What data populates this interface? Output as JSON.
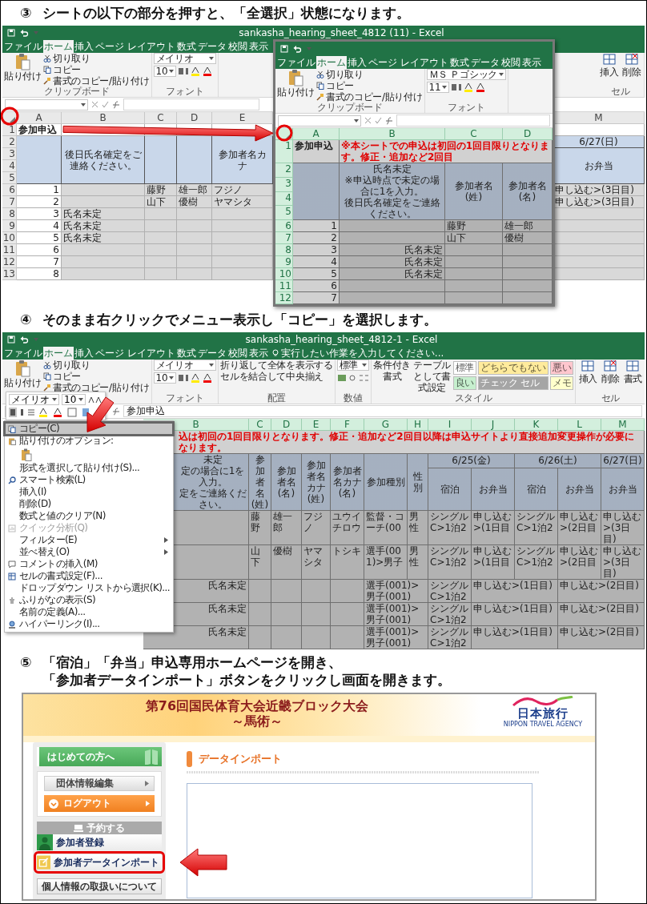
{
  "steps": [
    {
      "marker": "③",
      "lines": [
        "シートの以下の部分を押すと、「全選択」状態になります。"
      ],
      "figure": {
        "kind": "excel-zoom",
        "sheets": [
          {
            "kind": "back",
            "title": "sankasha_hearing_sheet_4812 (11) - Excel",
            "all_selected": false,
            "tabs": [
              {
                "label": "ファイル",
                "selected": false
              },
              {
                "label": "ホーム",
                "selected": true
              },
              {
                "label": "挿入",
                "selected": false
              },
              {
                "label": "ページ レイアウト",
                "selected": false
              },
              {
                "label": "数式",
                "selected": false
              },
              {
                "label": "データ",
                "selected": false
              },
              {
                "label": "校閲",
                "selected": false
              },
              {
                "label": "表示",
                "selected": false
              }
            ],
            "ribbon": [
              {
                "kind": "clipboard",
                "paste": "貼り付け",
                "items": [
                  "切り取り",
                  "コピー",
                  "書式のコピー/貼り付け"
                ],
                "label": "クリップボード"
              },
              {
                "kind": "font",
                "font": "メイリオ",
                "size": "10",
                "label": "フォント"
              },
              {
                "kind": "gap"
              },
              {
                "kind": "cells",
                "items": [
                  "挿入",
                  "削除"
                ],
                "label": "セル"
              }
            ],
            "columns": [
              "A",
              "B",
              "C",
              "D",
              "E",
              "M"
            ],
            "rows": [
              {
                "num": "1",
                "kind": "blank",
                "cells": [
                  {
                    "kind": "title",
                    "text": "参加申込"
                  }
                ]
              },
              {
                "num": "2",
                "cells": [
                  {
                    "kind": "header"
                  },
                  {
                    "kind": "header",
                    "text": "後日氏名確定をご連絡ください。"
                  },
                  {
                    "kind": "header"
                  },
                  {
                    "kind": "header"
                  },
                  {
                    "kind": "header",
                    "text": "参加者名カナ"
                  },
                  {
                    "kind": "header",
                    "text": "6/27(日)"
                  }
                ]
              },
              {
                "num": "3",
                "cells": [
                  {
                    "kind": "merge-up"
                  },
                  {
                    "kind": "merge-up"
                  },
                  {
                    "kind": "merge-up"
                  },
                  {
                    "kind": "merge-up"
                  },
                  {
                    "kind": "merge-up"
                  },
                  {
                    "kind": "header",
                    "text": "お弁当"
                  }
                ]
              },
              {
                "num": "4",
                "cells": [
                  {
                    "kind": "merge-up"
                  },
                  {
                    "kind": "merge-up"
                  },
                  {
                    "kind": "merge-up"
                  },
                  {
                    "kind": "merge-up"
                  },
                  {
                    "kind": "merge-up"
                  },
                  {
                    "kind": "merge-up"
                  }
                ]
              },
              {
                "num": "5",
                "cells": [
                  {
                    "kind": "merge-up"
                  },
                  {
                    "kind": "merge-up"
                  },
                  {
                    "kind": "merge-up"
                  },
                  {
                    "kind": "merge-up"
                  },
                  {
                    "kind": "merge-up"
                  },
                  {
                    "kind": "merge-up"
                  }
                ]
              },
              {
                "num": "6",
                "cells": [
                  {
                    "kind": "num",
                    "text": "1"
                  },
                  {
                    "kind": "data"
                  },
                  {
                    "kind": "data",
                    "text": "藤野"
                  },
                  {
                    "kind": "data",
                    "text": "雄一郎"
                  },
                  {
                    "kind": "data",
                    "text": "フジノ"
                  },
                  {
                    "kind": "data",
                    "text": "申し込む>(3日目)"
                  }
                ]
              },
              {
                "num": "7",
                "cells": [
                  {
                    "kind": "num",
                    "text": "2"
                  },
                  {
                    "kind": "data"
                  },
                  {
                    "kind": "data",
                    "text": "山下"
                  },
                  {
                    "kind": "data",
                    "text": "優樹"
                  },
                  {
                    "kind": "data",
                    "text": "ヤマシタ"
                  },
                  {
                    "kind": "data",
                    "text": "申し込む>(3日目)"
                  }
                ]
              },
              {
                "num": "8",
                "kind": "data",
                "cells": [
                  {
                    "kind": "num",
                    "text": "3"
                  },
                  {
                    "kind": "data",
                    "text": "氏名未定"
                  }
                ]
              },
              {
                "num": "9",
                "kind": "data",
                "cells": [
                  {
                    "kind": "num",
                    "text": "4"
                  },
                  {
                    "kind": "data",
                    "text": "氏名未定"
                  }
                ]
              },
              {
                "num": "10",
                "kind": "data",
                "cells": [
                  {
                    "kind": "num",
                    "text": "5"
                  },
                  {
                    "kind": "data",
                    "text": "氏名未定"
                  }
                ]
              },
              {
                "num": "11",
                "kind": "data",
                "cells": [
                  {
                    "kind": "num",
                    "text": "6"
                  }
                ]
              },
              {
                "num": "12",
                "kind": "data",
                "cells": [
                  {
                    "kind": "num",
                    "text": "7"
                  }
                ]
              },
              {
                "num": "13",
                "kind": "data",
                "cells": [
                  {
                    "kind": "num",
                    "text": "8"
                  }
                ]
              }
            ]
          },
          {
            "kind": "zoom",
            "all_selected": true,
            "tabs": [
              {
                "label": "ファイル",
                "selected": false
              },
              {
                "label": "ホーム",
                "selected": true
              },
              {
                "label": "挿入",
                "selected": false
              },
              {
                "label": "ページ レイアウト",
                "selected": false
              },
              {
                "label": "数式",
                "selected": false
              },
              {
                "label": "データ",
                "selected": false
              },
              {
                "label": "校閲",
                "selected": false
              },
              {
                "label": "表示",
                "selected": false
              }
            ],
            "ribbon": [
              {
                "kind": "clipboard",
                "paste": "貼り付け",
                "items": [
                  "切り取り",
                  "コピー",
                  "書式のコピー/貼り付け"
                ],
                "label": "クリップボード"
              },
              {
                "kind": "font",
                "font": "ＭＳ Ｐゴシック",
                "size": "11",
                "label": "フォント"
              }
            ],
            "columns": [
              "A",
              "B",
              "C",
              "D"
            ],
            "rows": [
              {
                "num": "1",
                "cells": [
                  {
                    "kind": "title",
                    "text": "参加申込"
                  },
                  {
                    "kind": "note",
                    "text": "※本シートでの申込は初回の1回目限りとなります。修正・追加など2回目"
                  },
                  {
                    "kind": "merge-left"
                  },
                  {
                    "kind": "merge-left"
                  }
                ]
              },
              {
                "num": "2",
                "cells": [
                  {
                    "kind": "header"
                  },
                  {
                    "kind": "header",
                    "lines": [
                      "氏名未定",
                      "※申込時点で未定の場合に1を入力。",
                      "後日氏名確定をご連絡ください。"
                    ]
                  },
                  {
                    "kind": "header",
                    "text": "参加者名(姓)"
                  },
                  {
                    "kind": "header",
                    "text": "参加者名(名)"
                  }
                ]
              },
              {
                "num": "3",
                "cells": [
                  {
                    "kind": "merge-up"
                  },
                  {
                    "kind": "merge-up"
                  },
                  {
                    "kind": "merge-up"
                  },
                  {
                    "kind": "merge-up"
                  }
                ]
              },
              {
                "num": "4",
                "cells": [
                  {
                    "kind": "merge-up"
                  },
                  {
                    "kind": "merge-up"
                  },
                  {
                    "kind": "merge-up"
                  },
                  {
                    "kind": "merge-up"
                  }
                ]
              },
              {
                "num": "5",
                "cells": [
                  {
                    "kind": "merge-up"
                  },
                  {
                    "kind": "merge-up"
                  },
                  {
                    "kind": "merge-up"
                  },
                  {
                    "kind": "merge-up"
                  }
                ]
              },
              {
                "num": "6",
                "cells": [
                  {
                    "kind": "num",
                    "text": "1"
                  },
                  {
                    "kind": "data"
                  },
                  {
                    "kind": "data",
                    "text": "藤野"
                  },
                  {
                    "kind": "data",
                    "text": "雄一郎"
                  }
                ]
              },
              {
                "num": "7",
                "cells": [
                  {
                    "kind": "num",
                    "text": "2"
                  },
                  {
                    "kind": "data"
                  },
                  {
                    "kind": "data",
                    "text": "山下"
                  },
                  {
                    "kind": "data",
                    "text": "優樹"
                  }
                ]
              },
              {
                "num": "8",
                "kind": "data",
                "cells": [
                  {
                    "kind": "num",
                    "text": "3"
                  },
                  {
                    "kind": "data-right",
                    "text": "氏名未定"
                  }
                ]
              },
              {
                "num": "9",
                "kind": "data",
                "cells": [
                  {
                    "kind": "num",
                    "text": "4"
                  },
                  {
                    "kind": "data-right",
                    "text": "氏名未定"
                  }
                ]
              },
              {
                "num": "10",
                "kind": "data",
                "cells": [
                  {
                    "kind": "num",
                    "text": "5"
                  },
                  {
                    "kind": "data-right",
                    "text": "氏名未定"
                  }
                ]
              },
              {
                "num": "11",
                "kind": "data",
                "cells": [
                  {
                    "kind": "num",
                    "text": "6"
                  }
                ]
              },
              {
                "num": "12",
                "kind": "data",
                "cells": [
                  {
                    "kind": "num",
                    "text": "7"
                  }
                ]
              }
            ]
          }
        ]
      }
    },
    {
      "marker": "④",
      "lines": [
        "そのまま右クリックでメニュー表示し「コピー」を選択します。"
      ],
      "figure": {
        "kind": "excel-menu",
        "sheets": [
          {
            "kind": "menu",
            "title": "sankasha_hearing_sheet_4812-1 - Excel",
            "all_selected": true,
            "tell_me": "実行したい作業を入力してください...",
            "formula": "参加申込",
            "tabs": [
              {
                "label": "ファイル",
                "selected": false
              },
              {
                "label": "ホーム",
                "selected": true
              },
              {
                "label": "挿入",
                "selected": false
              },
              {
                "label": "ページ レイアウト",
                "selected": false
              },
              {
                "label": "数式",
                "selected": false
              },
              {
                "label": "データ",
                "selected": false
              },
              {
                "label": "校閲",
                "selected": false
              },
              {
                "label": "表示",
                "selected": false
              }
            ],
            "ribbon": [
              {
                "kind": "clipboard",
                "paste": "貼り付け",
                "items": [
                  "切り取り",
                  "コピー",
                  "書式のコピー/貼り付け"
                ]
              },
              {
                "kind": "font",
                "font": "メイリオ",
                "size": "10",
                "label": "フォント"
              },
              {
                "kind": "align",
                "items": [
                  "折り返して全体を表示する",
                  "セルを結合して中央揃え"
                ],
                "label": "配置"
              },
              {
                "kind": "number",
                "format": "標準",
                "label": "数値"
              },
              {
                "kind": "styles",
                "commands": [
                  "条件付き書式",
                  "テーブルとして書式設定"
                ],
                "tiles": [
                  {
                    "label": "標準",
                    "color": "#ffffff"
                  },
                  {
                    "label": "どちらでもない",
                    "color": "#ffeb9c"
                  },
                  {
                    "label": "悪い",
                    "color": "#ffc7ce"
                  },
                  {
                    "label": "良い",
                    "color": "#c6efce"
                  },
                  {
                    "label": "チェック セル",
                    "color": "#a5a5a5"
                  },
                  {
                    "label": "メモ",
                    "color": "#ffffcc"
                  }
                ],
                "label": "スタイル"
              },
              {
                "kind": "cells",
                "items": [
                  "挿入",
                  "削除",
                  "書式"
                ],
                "label": "セル"
              }
            ],
            "columns": [
              "B",
              "C",
              "D",
              "E",
              "F",
              "G",
              "H",
              "I",
              "J",
              "K",
              "L",
              "M"
            ],
            "rows": [
              {
                "cells": [
                  {
                    "kind": "note",
                    "text": "込は初回の1回目限りとなります。修正・追加など2回目以降は申込サイトより直接追加変更操作が必要になります。"
                  },
                  {
                    "kind": "merge-left"
                  },
                  {
                    "kind": "merge-left"
                  },
                  {
                    "kind": "merge-left"
                  },
                  {
                    "kind": "merge-left"
                  },
                  {
                    "kind": "merge-left"
                  },
                  {
                    "kind": "merge-left"
                  },
                  {
                    "kind": "merge-left"
                  },
                  {
                    "kind": "merge-left"
                  },
                  {
                    "kind": "merge-left"
                  },
                  {
                    "kind": "merge-left"
                  },
                  {
                    "kind": "merge-left"
                  }
                ]
              },
              {
                "cells": [
                  {
                    "kind": "header",
                    "lines": [
                      "未定",
                      "定の場合に1を入力。",
                      "定をご連絡ください。"
                    ]
                  },
                  {
                    "kind": "header",
                    "text": "参加者名(姓)"
                  },
                  {
                    "kind": "header",
                    "text": "参加者名(名)"
                  },
                  {
                    "kind": "header",
                    "text": "参加者名カナ(姓)"
                  },
                  {
                    "kind": "header",
                    "text": "参加者名カナ(名)"
                  },
                  {
                    "kind": "header",
                    "text": "参加種別"
                  },
                  {
                    "kind": "header",
                    "text": "性別"
                  },
                  {
                    "kind": "header",
                    "text": "6/25(金)"
                  },
                  {
                    "kind": "merge-left"
                  },
                  {
                    "kind": "header",
                    "text": "6/26(土)"
                  },
                  {
                    "kind": "merge-left"
                  },
                  {
                    "kind": "header",
                    "text": "6/27(日)"
                  }
                ]
              },
              {
                "cells": [
                  {
                    "kind": "merge-up"
                  },
                  {
                    "kind": "merge-up"
                  },
                  {
                    "kind": "merge-up"
                  },
                  {
                    "kind": "merge-up"
                  },
                  {
                    "kind": "merge-up"
                  },
                  {
                    "kind": "merge-up"
                  },
                  {
                    "kind": "merge-up"
                  },
                  {
                    "kind": "header",
                    "text": "宿泊"
                  },
                  {
                    "kind": "header",
                    "text": "お弁当"
                  },
                  {
                    "kind": "header",
                    "text": "宿泊"
                  },
                  {
                    "kind": "header",
                    "text": "お弁当"
                  },
                  {
                    "kind": "header",
                    "text": "お弁当"
                  }
                ]
              },
              {
                "cells": [
                  {
                    "kind": "merge-up"
                  },
                  {
                    "kind": "merge-up"
                  },
                  {
                    "kind": "merge-up"
                  },
                  {
                    "kind": "merge-up"
                  },
                  {
                    "kind": "merge-up"
                  },
                  {
                    "kind": "merge-up"
                  },
                  {
                    "kind": "merge-up"
                  },
                  {
                    "kind": "merge-up"
                  },
                  {
                    "kind": "merge-up"
                  },
                  {
                    "kind": "merge-up"
                  },
                  {
                    "kind": "merge-up"
                  },
                  {
                    "kind": "merge-up"
                  }
                ]
              },
              {
                "cells": [
                  {
                    "kind": "merge-up"
                  },
                  {
                    "kind": "merge-up"
                  },
                  {
                    "kind": "merge-up"
                  },
                  {
                    "kind": "merge-up"
                  },
                  {
                    "kind": "merge-up"
                  },
                  {
                    "kind": "merge-up"
                  },
                  {
                    "kind": "merge-up"
                  },
                  {
                    "kind": "merge-up"
                  },
                  {
                    "kind": "merge-up"
                  },
                  {
                    "kind": "merge-up"
                  },
                  {
                    "kind": "merge-up"
                  },
                  {
                    "kind": "merge-up"
                  }
                ]
              },
              {
                "cells": [
                  {
                    "kind": "data"
                  },
                  {
                    "kind": "data",
                    "text": "藤野"
                  },
                  {
                    "kind": "data",
                    "text": "雄一郎"
                  },
                  {
                    "kind": "data",
                    "text": "フジノ"
                  },
                  {
                    "kind": "data",
                    "text": "ユウイチロウ"
                  },
                  {
                    "kind": "data",
                    "text": "監督・コーチ(00"
                  },
                  {
                    "kind": "data",
                    "text": "男性"
                  },
                  {
                    "kind": "data",
                    "text": "シングルC>1泊2"
                  },
                  {
                    "kind": "data",
                    "text": "申し込む>(1日目"
                  },
                  {
                    "kind": "data",
                    "text": "シングルC>1泊2"
                  },
                  {
                    "kind": "data",
                    "text": "申し込む>(2日目"
                  },
                  {
                    "kind": "data",
                    "text": "申し込む>(3日目)"
                  }
                ]
              },
              {
                "cells": [
                  {
                    "kind": "data"
                  },
                  {
                    "kind": "data",
                    "text": "山下"
                  },
                  {
                    "kind": "data",
                    "text": "優樹"
                  },
                  {
                    "kind": "data",
                    "text": "ヤマシタ"
                  },
                  {
                    "kind": "data",
                    "text": "トシキ"
                  },
                  {
                    "kind": "data",
                    "text": "選手(001)>男子"
                  },
                  {
                    "kind": "data",
                    "text": "男性"
                  },
                  {
                    "kind": "data",
                    "text": "シングルC>1泊2"
                  },
                  {
                    "kind": "data",
                    "text": "申し込む>(1日目"
                  },
                  {
                    "kind": "data",
                    "text": "シングルC>1泊2"
                  },
                  {
                    "kind": "data",
                    "text": "申し込む>(2日目"
                  },
                  {
                    "kind": "data",
                    "text": "申し込む>(3日目)"
                  }
                ]
              },
              {
                "cells": [
                  {
                    "kind": "data-right",
                    "text": "氏名未定"
                  },
                  {
                    "kind": "data"
                  },
                  {
                    "kind": "data"
                  },
                  {
                    "kind": "data"
                  },
                  {
                    "kind": "data"
                  },
                  {
                    "kind": "data",
                    "text": "選手(001)>男子(001)"
                  },
                  {
                    "kind": "merge-left"
                  },
                  {
                    "kind": "data",
                    "text": "シングルC>1泊2"
                  },
                  {
                    "kind": "data",
                    "text": "申し込む>(1日目)"
                  },
                  {
                    "kind": "merge-left"
                  },
                  {
                    "kind": "data",
                    "text": "申し込む>(2日目)"
                  },
                  {
                    "kind": "merge-left"
                  }
                ]
              },
              {
                "cells": [
                  {
                    "kind": "data-right",
                    "text": "氏名未定"
                  },
                  {
                    "kind": "data"
                  },
                  {
                    "kind": "data"
                  },
                  {
                    "kind": "data"
                  },
                  {
                    "kind": "data"
                  },
                  {
                    "kind": "data",
                    "text": "選手(001)>男子(001)"
                  },
                  {
                    "kind": "merge-left"
                  },
                  {
                    "kind": "data",
                    "text": "シングルC>1泊2"
                  },
                  {
                    "kind": "data",
                    "text": "申し込む>(1日目)"
                  },
                  {
                    "kind": "merge-left"
                  },
                  {
                    "kind": "data",
                    "text": "申し込む>(2日目)"
                  },
                  {
                    "kind": "merge-left"
                  }
                ]
              },
              {
                "cells": [
                  {
                    "kind": "data-right",
                    "text": "氏名未定"
                  },
                  {
                    "kind": "data"
                  },
                  {
                    "kind": "data"
                  },
                  {
                    "kind": "data"
                  },
                  {
                    "kind": "data"
                  },
                  {
                    "kind": "data",
                    "text": "選手(001)>男子(001)"
                  },
                  {
                    "kind": "merge-left"
                  },
                  {
                    "kind": "data",
                    "text": "シングルC>1泊2"
                  },
                  {
                    "kind": "data",
                    "text": "申し込む>(1日目)"
                  },
                  {
                    "kind": "merge-left"
                  },
                  {
                    "kind": "data",
                    "text": "申し込む>(2日目)"
                  },
                  {
                    "kind": "merge-left"
                  }
                ]
              }
            ]
          }
        ],
        "mini_toolbar": {
          "font": "メイリオ",
          "size": "10"
        },
        "context_menu": [
          {
            "label": "コピー(C)",
            "kind": "copy",
            "selected": true,
            "disabled": false,
            "submenu": false
          },
          {
            "label": "貼り付けのオプション:",
            "kind": "paste-options",
            "selected": false,
            "disabled": false,
            "submenu": false
          },
          {
            "label": "形式を選択して貼り付け(S)...",
            "kind": "plain",
            "selected": false,
            "disabled": false,
            "submenu": false
          },
          {
            "label": "スマート検索(L)",
            "kind": "search",
            "selected": false,
            "disabled": false,
            "submenu": false
          },
          {
            "label": "挿入(I)",
            "kind": "plain",
            "selected": false,
            "disabled": false,
            "submenu": false
          },
          {
            "label": "削除(D)",
            "kind": "plain",
            "selected": false,
            "disabled": false,
            "submenu": false
          },
          {
            "label": "数式と値のクリア(N)",
            "kind": "plain",
            "selected": false,
            "disabled": false,
            "submenu": false
          },
          {
            "label": "クイック分析(Q)",
            "kind": "quick",
            "selected": false,
            "disabled": true,
            "submenu": false
          },
          {
            "label": "フィルター(E)",
            "kind": "plain",
            "selected": false,
            "disabled": false,
            "submenu": true
          },
          {
            "label": "並べ替え(O)",
            "kind": "plain",
            "selected": false,
            "disabled": false,
            "submenu": true
          },
          {
            "label": "コメントの挿入(M)",
            "kind": "comment",
            "selected": false,
            "disabled": false,
            "submenu": false
          },
          {
            "label": "セルの書式設定(F)...",
            "kind": "format",
            "selected": false,
            "disabled": false,
            "submenu": false
          },
          {
            "label": "ドロップダウン リストから選択(K)...",
            "kind": "plain",
            "selected": false,
            "disabled": false,
            "submenu": false
          },
          {
            "label": "ふりがなの表示(S)",
            "kind": "furigana",
            "selected": false,
            "disabled": false,
            "submenu": false
          },
          {
            "label": "名前の定義(A)...",
            "kind": "plain",
            "selected": false,
            "disabled": false,
            "submenu": false
          },
          {
            "label": "ハイパーリンク(I)...",
            "kind": "link",
            "selected": false,
            "disabled": false,
            "submenu": false
          }
        ]
      }
    },
    {
      "marker": "⑤",
      "lines": [
        "「宿泊」「弁当」申込専用ホームページを開き、",
        "「参加者データインポート」ボタンをクリックし画面を開きます。"
      ],
      "figure": {
        "kind": "portal",
        "portal": {
          "banner": {
            "title": "第76回国民体育大会近畿ブロック大会",
            "subtitle": "～馬術～",
            "logo": "日本旅行",
            "logo_sub": "NIPPON TRAVEL AGENCY"
          },
          "sidebar": {
            "guide": "はじめての方へ",
            "account": [
              {
                "label": "団体情報編集",
                "kind": "gray"
              },
              {
                "label": "ログアウト",
                "kind": "orange"
              }
            ],
            "section": "予約する",
            "items": [
              {
                "label": "参加者登録",
                "kind": "person",
                "highlighted": false
              },
              {
                "label": "参加者データインポート",
                "kind": "import",
                "highlighted": true
              }
            ],
            "footer": "個人情報の取扱いについて"
          },
          "main": {
            "heading": "データインポート"
          }
        }
      }
    }
  ]
}
